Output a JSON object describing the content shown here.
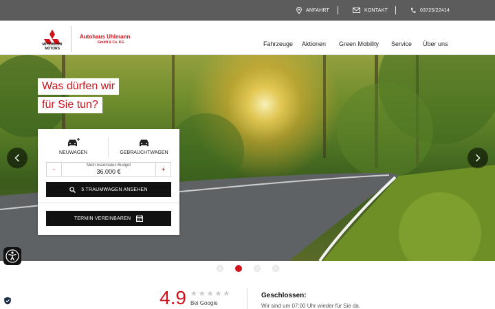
{
  "topbar": {
    "anfahrt": "ANFAHRT",
    "kontakt": "KONTAKT",
    "phone": "03725/22414"
  },
  "brand": {
    "logo_text": "MITSUBISHI MOTORS",
    "dealer_name": "Autohaus Uhlmann",
    "dealer_suffix": "GmbH & Co. KG"
  },
  "nav": {
    "items": [
      "Fahrzeuge",
      "Aktionen",
      "Green Mobility",
      "Service",
      "Über uns"
    ]
  },
  "hero": {
    "title_line1": "Was dürfen wir",
    "title_line2": "für Sie tun?"
  },
  "search_card": {
    "tab_new": "NEUWAGEN",
    "tab_used": "GEBRAUCHTWAGEN",
    "budget_label": "Mein maximales Budget",
    "budget_value": "36.000 €",
    "minus": "-",
    "plus": "+",
    "search_button": "5 TRAUMWAGEN ANSEHEN",
    "appointment_button": "TERMIN VEREINBAREN"
  },
  "slider": {
    "dot_count": 4,
    "active_dot": 2
  },
  "reviews": {
    "rating": "4.9",
    "stars": "★★★★★",
    "source": "Bei Google"
  },
  "opening": {
    "status": "Geschlossen:",
    "message": "Wir sind um 07:00 Uhr wieder für Sie da."
  },
  "colors": {
    "accent": "#d0121b",
    "topbar": "#5c5c5c",
    "button": "#111111"
  }
}
